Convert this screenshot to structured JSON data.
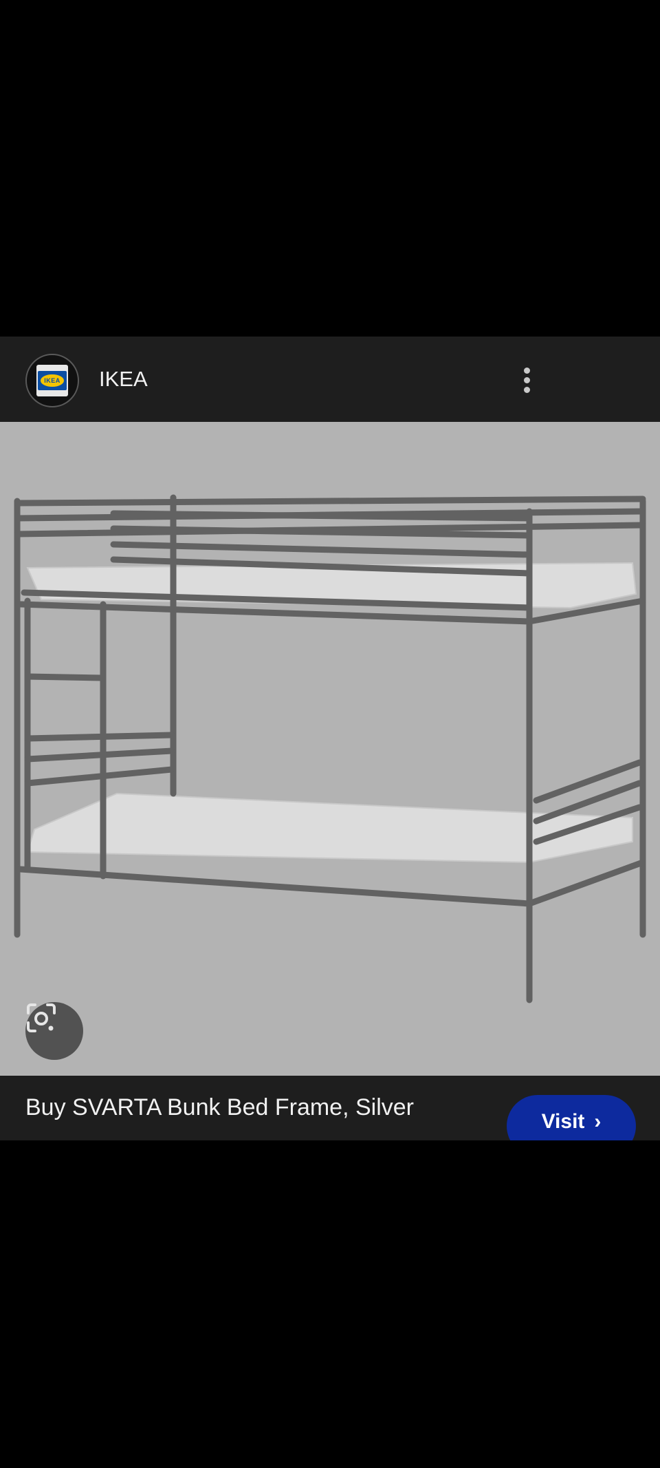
{
  "header": {
    "site_name": "IKEA",
    "logo_text": "IKEA",
    "menu_icon": "more-vert-icon"
  },
  "image": {
    "alt": "SVARTA Bunk Bed Frame, Silver",
    "lens_icon": "google-lens-icon"
  },
  "result": {
    "title": "Buy SVARTA Bunk Bed Frame, Silver",
    "visit_label": "Visit",
    "visit_icon": "chevron-right-icon"
  },
  "colors": {
    "card_bg": "#1e1e1e",
    "image_bg": "#b3b3b3",
    "visit_button": "#0d2a9e"
  }
}
